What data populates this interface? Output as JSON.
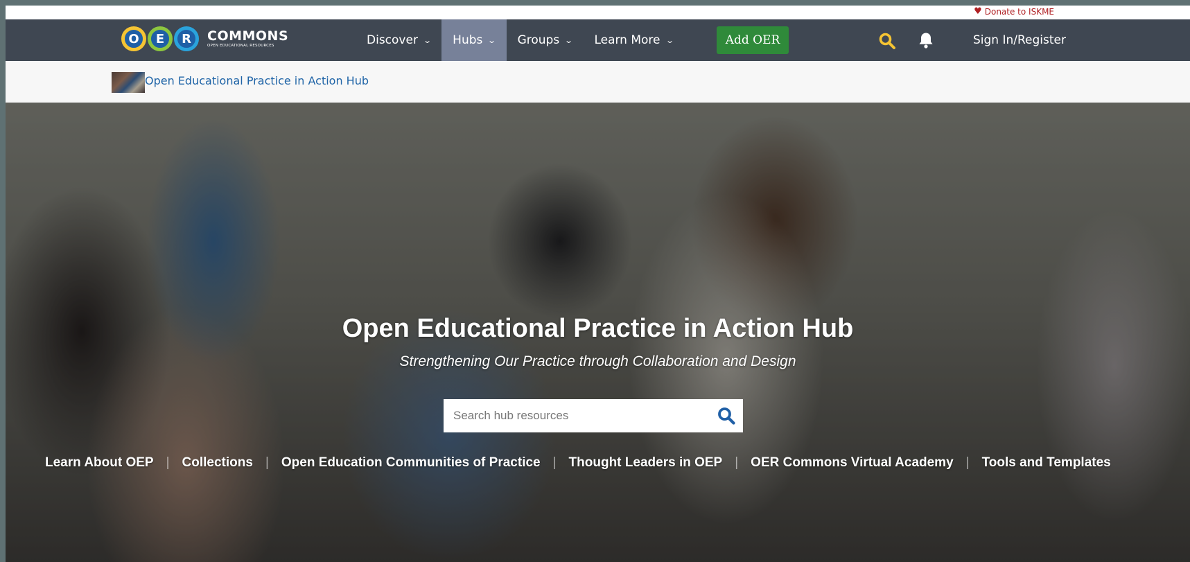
{
  "top": {
    "donate_label": "Donate to ISKME"
  },
  "logo": {
    "letters": [
      "O",
      "E",
      "R"
    ],
    "name": "COMMONS",
    "tagline": "OPEN EDUCATIONAL RESOURCES"
  },
  "nav": {
    "items": [
      {
        "label": "Discover",
        "active": false
      },
      {
        "label": "Hubs",
        "active": true
      },
      {
        "label": "Groups",
        "active": false
      },
      {
        "label": "Learn More",
        "active": false
      }
    ],
    "add_button": "Add OER",
    "signin": "Sign In/Register",
    "icons": {
      "search": "search-icon",
      "notifications": "bell-icon",
      "chevron": "chevron-down-icon",
      "donate": "heart-icon"
    }
  },
  "hub": {
    "link_label": "Open Educational Practice in Action Hub"
  },
  "hero": {
    "title": "Open Educational Practice in Action Hub",
    "subtitle": "Strengthening Our Practice through Collaboration and Design",
    "search_placeholder": "Search hub resources",
    "links": [
      "Learn About OEP",
      "Collections",
      "Open Education Communities of Practice",
      "Thought Leaders in OEP",
      "OER Commons Virtual Academy",
      "Tools and Templates"
    ]
  },
  "colors": {
    "nav_bg": "#3f4752",
    "nav_active": "#778199",
    "add_button": "#2f8a3a",
    "donate": "#b02023",
    "search_icon_nav": "#f5c433",
    "search_icon_hero": "#1f5fa6",
    "hub_link": "#1f64a7"
  }
}
